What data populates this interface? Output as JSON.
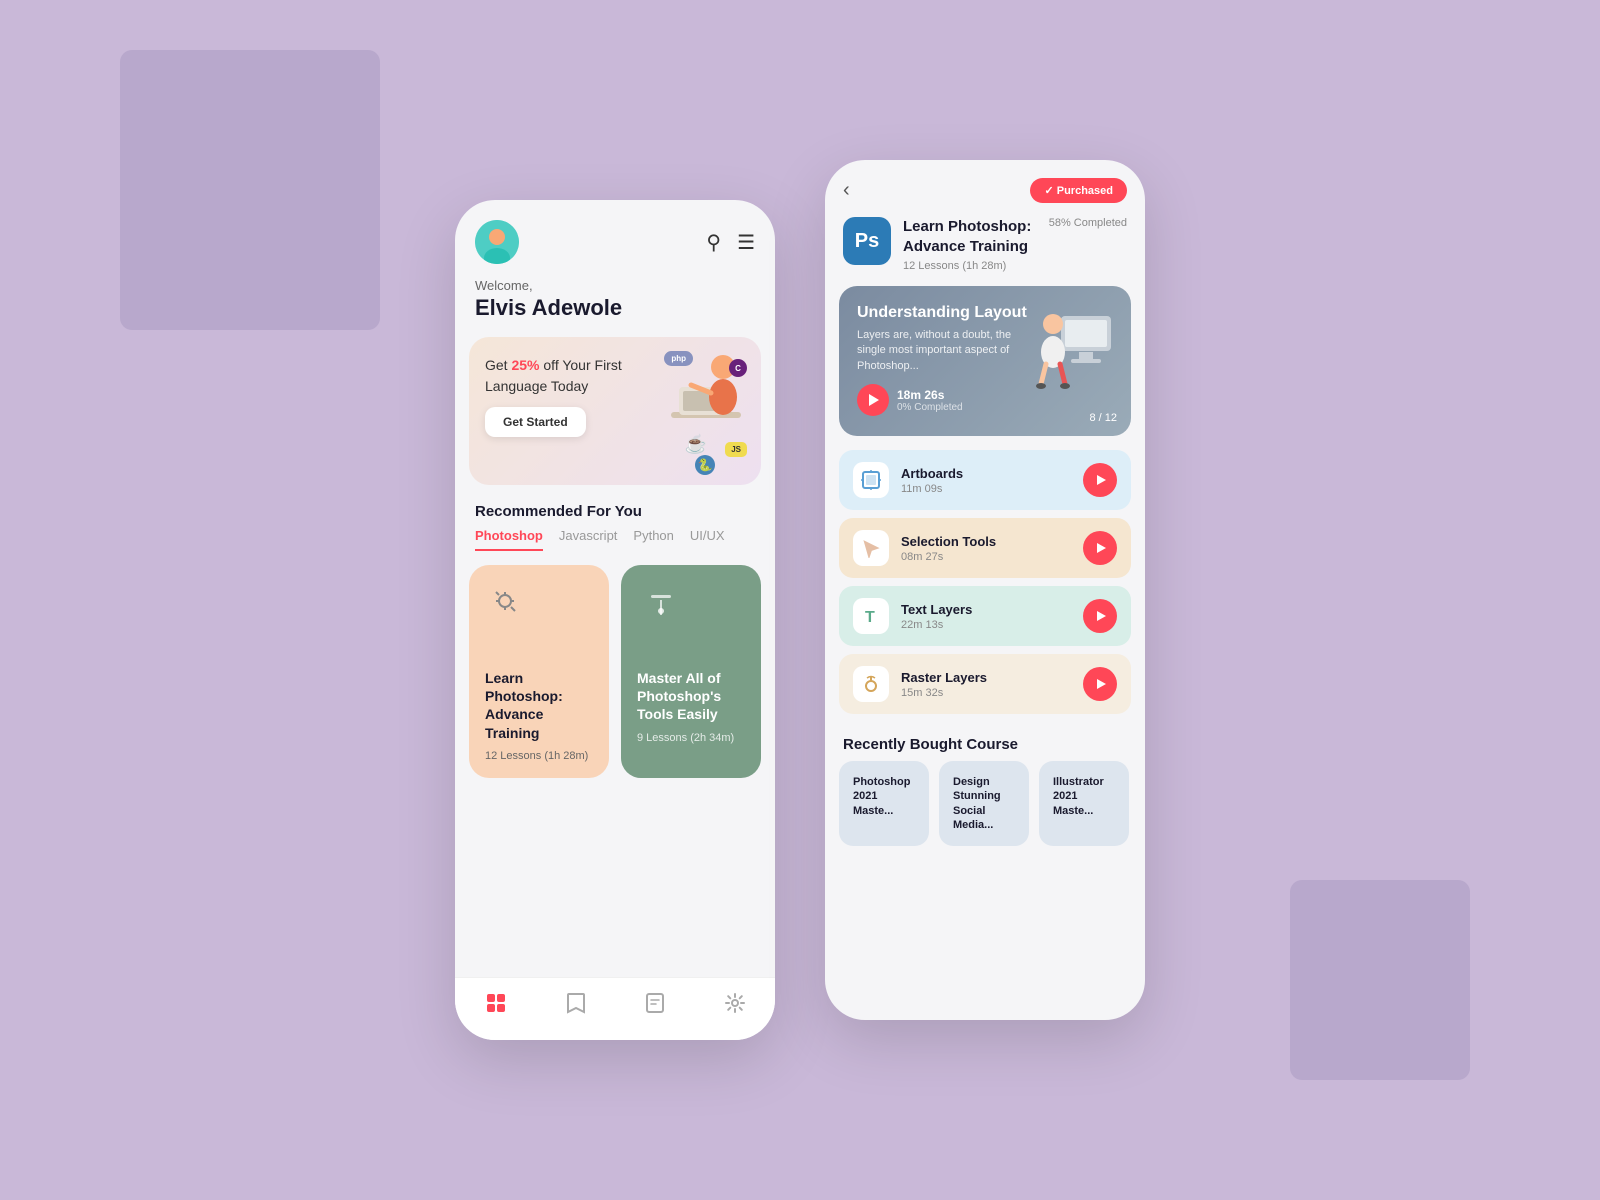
{
  "background": {
    "color": "#c9b8d8"
  },
  "phone1": {
    "welcome_label": "Welcome,",
    "user_name": "Elvis Adewole",
    "banner": {
      "text_pre": "Get ",
      "discount": "25%",
      "text_post": " off Your First Language Today",
      "button_label": "Get Started"
    },
    "recommended_label": "Recommended For You",
    "tabs": [
      {
        "label": "Photoshop",
        "active": true
      },
      {
        "label": "Javascript",
        "active": false
      },
      {
        "label": "Python",
        "active": false
      },
      {
        "label": "UI/UX",
        "active": false
      }
    ],
    "courses": [
      {
        "title": "Learn Photoshop: Advance Training",
        "lessons": "12 Lessons (1h 28m)",
        "bg": "#f9d4b8"
      },
      {
        "title": "Master All of Photoshop's Tools Easily",
        "lessons": "9 Lessons (2h 34m)",
        "bg": "#7a9e87"
      }
    ],
    "nav": [
      "grid",
      "bookmark",
      "folder",
      "settings"
    ]
  },
  "phone2": {
    "back_icon": "‹",
    "purchased_label": "✓ Purchased",
    "course": {
      "icon_text": "Ps",
      "title": "Learn Photoshop: Advance Training",
      "meta": "12 Lessons (1h 28m)",
      "progress": "58% Completed"
    },
    "featured_lesson": {
      "title": "Understanding Layout",
      "description": "Layers are, without a doubt, the single most important aspect of Photoshop...",
      "time": "18m 26s",
      "completed": "0% Completed",
      "pagination": "8 / 12"
    },
    "lessons": [
      {
        "title": "Artboards",
        "duration": "11m 09s",
        "icon": "⊡"
      },
      {
        "title": "Selection Tools",
        "duration": "08m 27s",
        "icon": "↖"
      },
      {
        "title": "Text Layers",
        "duration": "22m 13s",
        "icon": "T"
      },
      {
        "title": "Raster Layers",
        "duration": "15m 32s",
        "icon": "🔑"
      }
    ],
    "recently_label": "Recently Bought Course",
    "recent_courses": [
      {
        "title": "Photoshop 2021 Maste..."
      },
      {
        "title": "Design Stunning Social Media..."
      },
      {
        "title": "Illustrator 2021 Maste..."
      }
    ]
  }
}
